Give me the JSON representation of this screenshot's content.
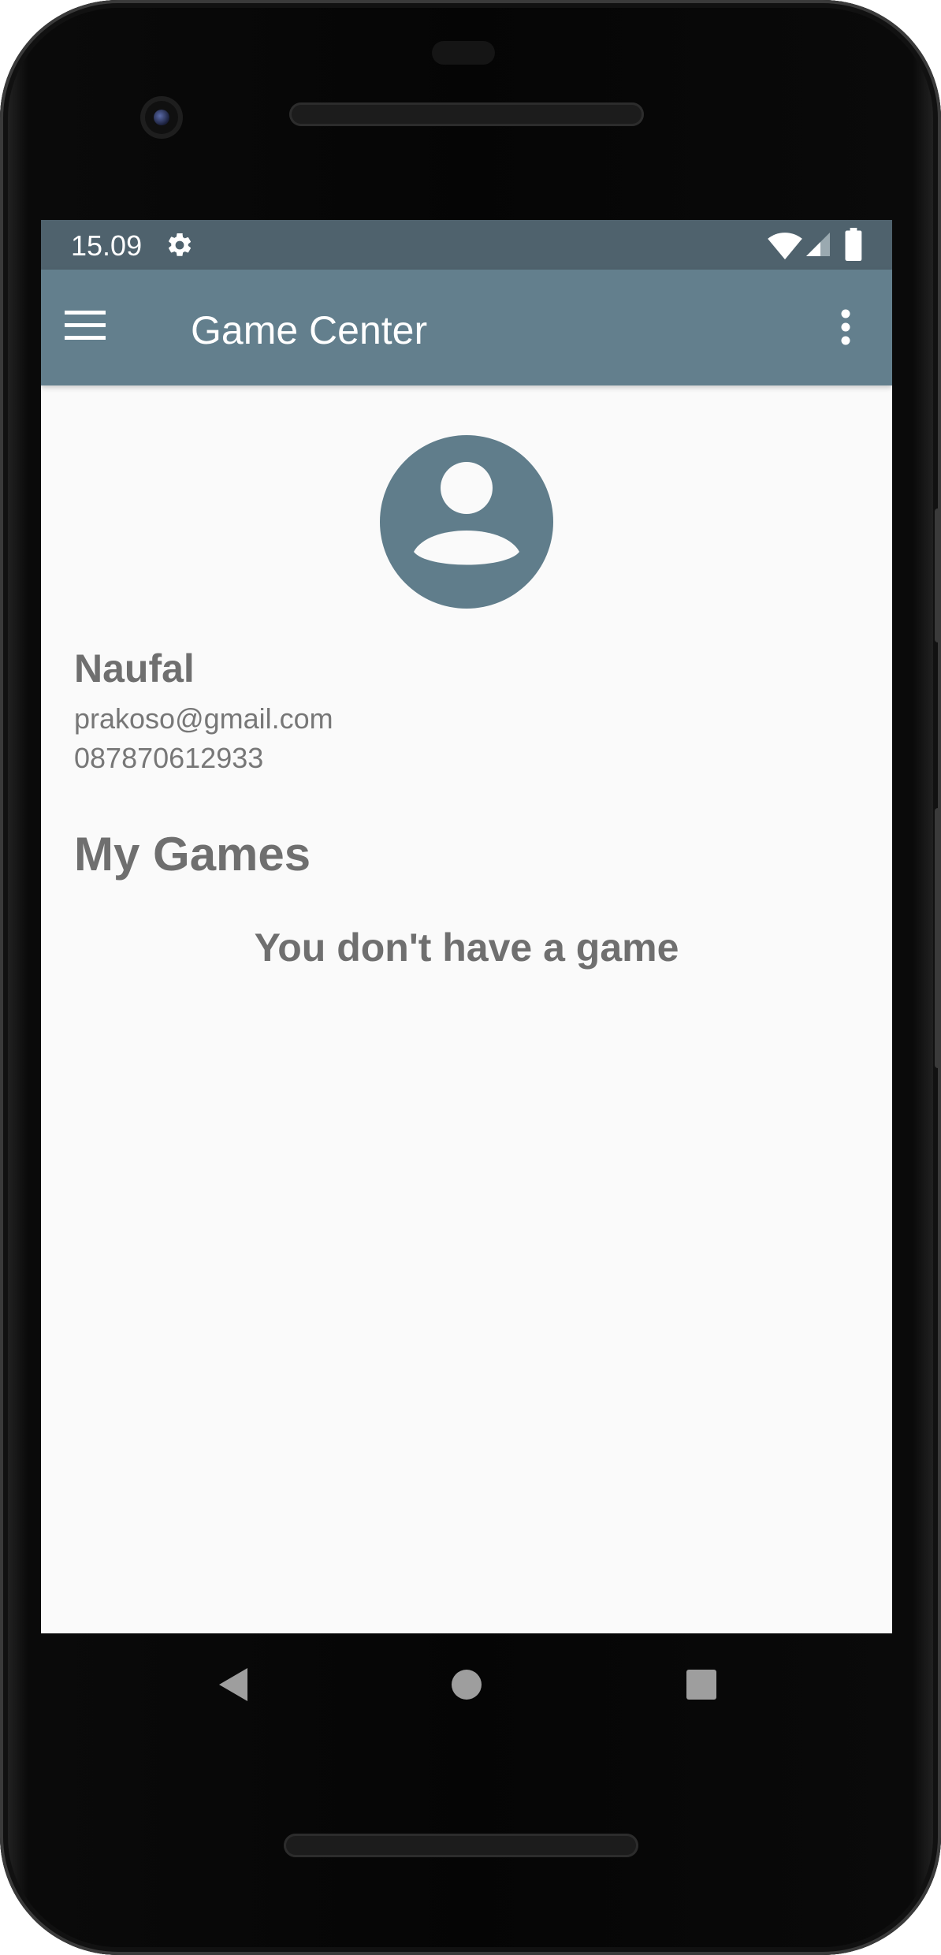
{
  "status_bar": {
    "time": "15.09",
    "icons": [
      "settings-gear-icon",
      "wifi-icon",
      "cellular-signal-icon",
      "battery-icon"
    ]
  },
  "app_bar": {
    "title": "Game Center",
    "menu_icon": "hamburger-menu-icon",
    "overflow_icon": "more-vertical-icon"
  },
  "profile": {
    "avatar_icon": "account-circle-icon",
    "name": "Naufal",
    "email": "prakoso@gmail.com",
    "phone": "087870612933"
  },
  "games": {
    "section_title": "My Games",
    "empty_message": "You don't have a game"
  },
  "nav_bar": {
    "buttons": [
      "back-icon",
      "home-icon",
      "recents-icon"
    ]
  },
  "colors": {
    "status_bar": "#4f626d",
    "app_bar": "#637f8d",
    "accent": "#607d8b",
    "background": "#fafafa",
    "text_primary": "#6f6f6f"
  }
}
